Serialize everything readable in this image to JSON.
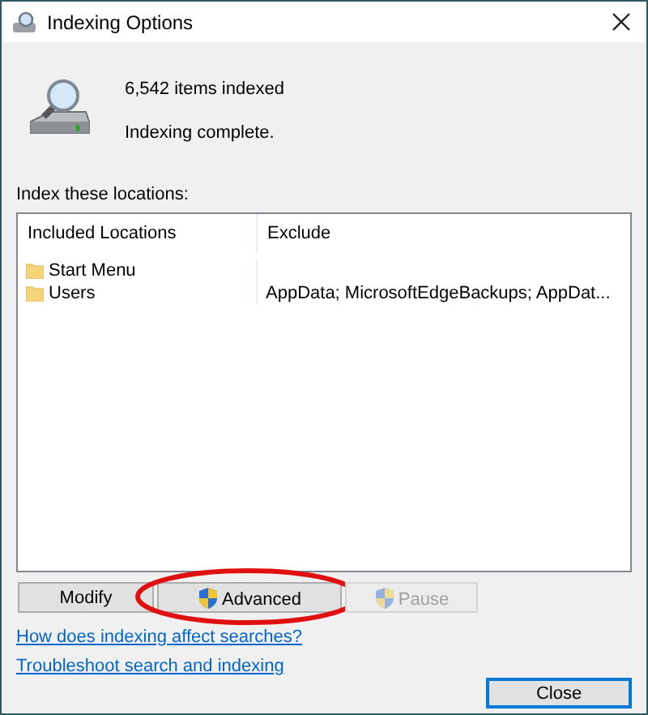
{
  "window": {
    "title": "Indexing Options"
  },
  "status": {
    "count": "6,542 items indexed",
    "message": "Indexing complete."
  },
  "locations_label": "Index these locations:",
  "table": {
    "columns": [
      "Included Locations",
      "Exclude"
    ],
    "rows": [
      {
        "location": "Start Menu",
        "exclude": ""
      },
      {
        "location": "Users",
        "exclude": "AppData; MicrosoftEdgeBackups; AppDat..."
      }
    ]
  },
  "buttons": [
    {
      "label": "Modify",
      "shield": false,
      "disabled": false,
      "circled": false
    },
    {
      "label": "Advanced",
      "shield": true,
      "disabled": false,
      "circled": true
    },
    {
      "label": "Pause",
      "shield": true,
      "disabled": true,
      "circled": false
    }
  ],
  "links": [
    "How does indexing affect searches?",
    "Troubleshoot search and indexing"
  ],
  "close_button": "Close"
}
